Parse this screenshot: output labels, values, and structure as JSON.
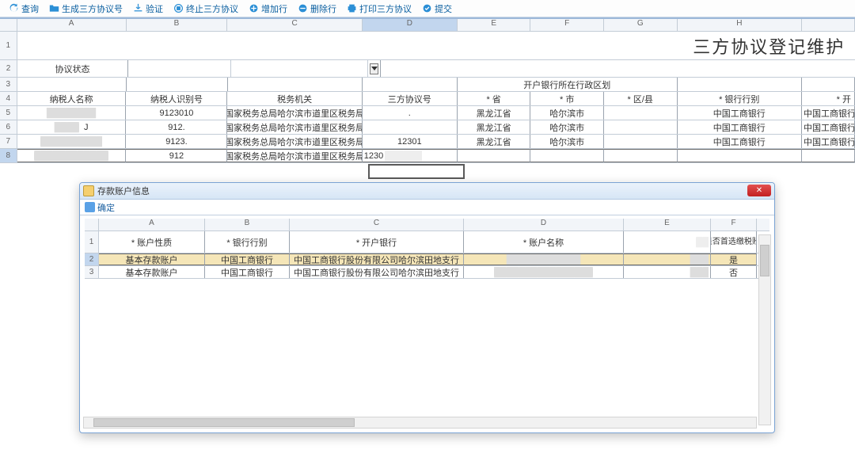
{
  "toolbar": {
    "items": [
      {
        "label": "查询",
        "icon": "refresh"
      },
      {
        "label": "生成三方协议号",
        "icon": "folder"
      },
      {
        "label": "验证",
        "icon": "download"
      },
      {
        "label": "终止三方协议",
        "icon": "stop"
      },
      {
        "label": "增加行",
        "icon": "plus"
      },
      {
        "label": "删除行",
        "icon": "minus"
      },
      {
        "label": "打印三方协议",
        "icon": "print"
      },
      {
        "label": "提交",
        "icon": "check"
      }
    ]
  },
  "title": "三方协议登记维护",
  "colLetters": [
    "A",
    "B",
    "C",
    "D",
    "E",
    "F",
    "G",
    "H"
  ],
  "headers": {
    "agreeStatus": "协议状态",
    "taxpayerName": "纳税人名称",
    "taxpayerId": "纳税人识别号",
    "taxOrg": "税务机关",
    "agreeNo": "三方协议号",
    "bankRegion": "开户银行所在行政区划",
    "province": "* 省",
    "city": "* 市",
    "district": "* 区/县",
    "bankType": "* 银行行别",
    "openBank": "* 开"
  },
  "rows": [
    {
      "name": "████████",
      "name2": "",
      "id": "9123010",
      "org": "国家税务总局哈尔滨市道里区税务局",
      "no": ".",
      "province": "黑龙江省",
      "city": "哈尔滨市",
      "district": "",
      "bank": "中国工商银行",
      "open": "中国工商银行"
    },
    {
      "name": "████",
      "name2": "J",
      "id": "912.",
      "org": "国家税务总局哈尔滨市道里区税务局",
      "no": "",
      "province": "黑龙江省",
      "city": "哈尔滨市",
      "district": "",
      "bank": "中国工商银行",
      "open": "中国工商银行"
    },
    {
      "name": "██████████",
      "name2": "",
      "id": "9123.",
      "org": "国家税务总局哈尔滨市道里区税务局",
      "no": "12301",
      "province": "黑龙江省",
      "city": "哈尔滨市",
      "district": "",
      "bank": "中国工商银行",
      "open": "中国工商银行"
    },
    {
      "name": "████████████",
      "name2": "",
      "id": "912",
      "org": "国家税务总局哈尔滨市道里区税务局",
      "no": "1230",
      "noMask": "██████",
      "province": "",
      "city": "",
      "district": "",
      "bank": "",
      "open": ""
    }
  ],
  "modal": {
    "title": "存款账户信息",
    "confirm": "确定",
    "colLetters": [
      "A",
      "B",
      "C",
      "D",
      "E",
      "F"
    ],
    "headers": {
      "accType": "* 账户性质",
      "bankType": "* 银行行别",
      "openBank": "* 开户银行",
      "accName": "* 账户名称",
      "blankE": "",
      "firstPick": "* 是否首选缴税账户"
    },
    "rows": [
      {
        "accType": "基本存款账户",
        "bankType": "中国工商银行",
        "openBank": "中国工商银行股份有限公司哈尔滨田地支行",
        "accName": "████████████",
        "e": "███",
        "firstPick": "是"
      },
      {
        "accType": "基本存款账户",
        "bankType": "中国工商银行",
        "openBank": "中国工商银行股份有限公司哈尔滨田地支行",
        "accName": "████████████████",
        "e": "███",
        "firstPick": "否"
      }
    ]
  }
}
